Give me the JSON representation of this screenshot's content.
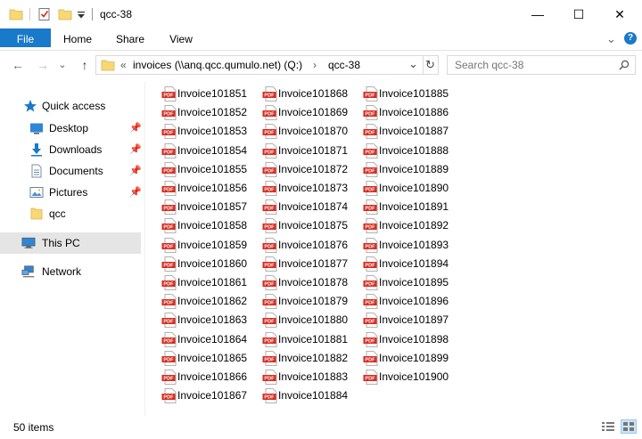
{
  "window": {
    "title": "qcc-38"
  },
  "controls": {
    "minimize": "—",
    "maximize": "☐",
    "close": "✕",
    "expand_ribbon": "⌄",
    "help": "?"
  },
  "ribbon": {
    "tabs": [
      {
        "label": "File"
      },
      {
        "label": "Home"
      },
      {
        "label": "Share"
      },
      {
        "label": "View"
      }
    ]
  },
  "nav": {
    "back": "←",
    "forward": "→",
    "history": "⌄",
    "up": "↑",
    "refresh": "↻",
    "dropdown": "⌄",
    "overflow": "«",
    "breadcrumb": [
      {
        "label": "invoices (\\\\anq.qcc.qumulo.net) (Q:)"
      },
      {
        "label": "qcc-38"
      }
    ],
    "separator": "›",
    "search_placeholder": "Search qcc-38"
  },
  "sidebar": {
    "quick_access": "Quick access",
    "items": [
      {
        "label": "Desktop",
        "pinned": true,
        "icon": "desktop-icon"
      },
      {
        "label": "Downloads",
        "pinned": true,
        "icon": "downloads-icon"
      },
      {
        "label": "Documents",
        "pinned": true,
        "icon": "documents-icon"
      },
      {
        "label": "Pictures",
        "pinned": true,
        "icon": "pictures-icon"
      },
      {
        "label": "qcc",
        "pinned": false,
        "icon": "folder-icon"
      }
    ],
    "this_pc": "This PC",
    "network": "Network",
    "pin_glyph": "📌"
  },
  "files": {
    "icon_text": "PDF",
    "names": [
      "Invoice101851",
      "Invoice101852",
      "Invoice101853",
      "Invoice101854",
      "Invoice101855",
      "Invoice101856",
      "Invoice101857",
      "Invoice101858",
      "Invoice101859",
      "Invoice101860",
      "Invoice101861",
      "Invoice101862",
      "Invoice101863",
      "Invoice101864",
      "Invoice101865",
      "Invoice101866",
      "Invoice101867",
      "Invoice101868",
      "Invoice101869",
      "Invoice101870",
      "Invoice101871",
      "Invoice101872",
      "Invoice101873",
      "Invoice101874",
      "Invoice101875",
      "Invoice101876",
      "Invoice101877",
      "Invoice101878",
      "Invoice101879",
      "Invoice101880",
      "Invoice101881",
      "Invoice101882",
      "Invoice101883",
      "Invoice101884",
      "Invoice101885",
      "Invoice101886",
      "Invoice101887",
      "Invoice101888",
      "Invoice101889",
      "Invoice101890",
      "Invoice101891",
      "Invoice101892",
      "Invoice101893",
      "Invoice101894",
      "Invoice101895",
      "Invoice101896",
      "Invoice101897",
      "Invoice101898",
      "Invoice101899",
      "Invoice101900"
    ]
  },
  "status": {
    "count": "50 items"
  },
  "colors": {
    "accent": "#1979ca",
    "pdf_red": "#d62b1f",
    "folder": "#f8d775",
    "selected": "#e5e5e5"
  }
}
